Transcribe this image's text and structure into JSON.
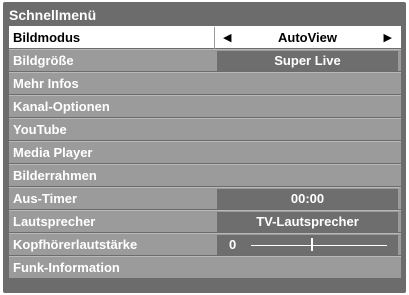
{
  "menu": {
    "title": "Schnellmenü",
    "items": [
      {
        "label": "Bildmodus",
        "value": "AutoView",
        "selected": true,
        "arrows": true
      },
      {
        "label": "Bildgröße",
        "value": "Super Live"
      },
      {
        "label": "Mehr Infos"
      },
      {
        "label": "Kanal-Optionen"
      },
      {
        "label": "YouTube"
      },
      {
        "label": "Media Player"
      },
      {
        "label": "Bilderrahmen"
      },
      {
        "label": "Aus-Timer",
        "value": "00:00"
      },
      {
        "label": "Lautsprecher",
        "value": "TV-Lautsprecher"
      },
      {
        "label": "Kopfhörerlautstärke",
        "slider_value": "0",
        "slider_level": 0.45
      },
      {
        "label": "Funk-Information"
      }
    ]
  },
  "icons": {
    "left": "left-arrow-icon",
    "right": "right-arrow-icon"
  },
  "colors": {
    "panel": "#6c6c6c",
    "row": "#9b9b9b",
    "value_box": "#6e6e6e",
    "selected_row": "#ffffff"
  }
}
